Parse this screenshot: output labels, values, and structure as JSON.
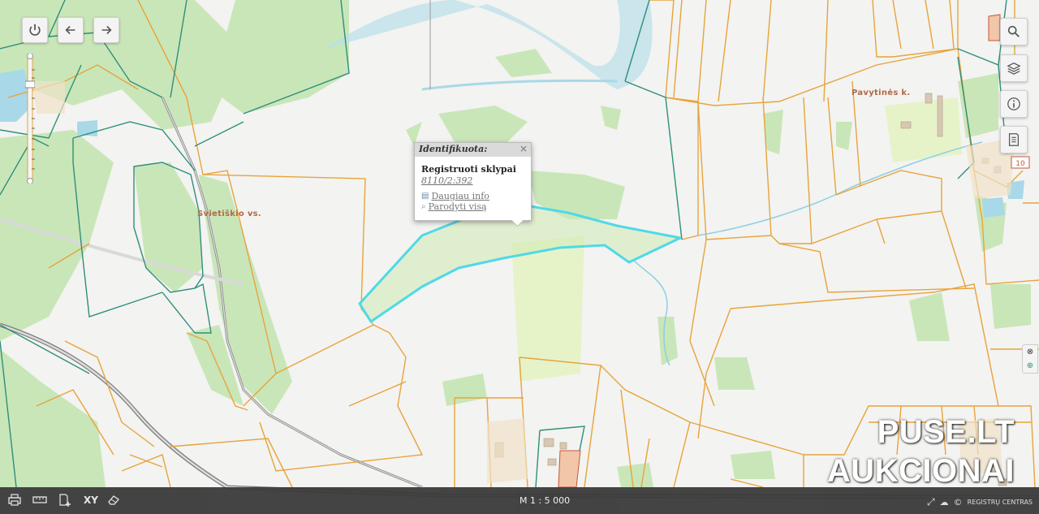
{
  "map": {
    "colors": {
      "background": "#f3f3f1",
      "forest": "#c9e6b9",
      "water": "#a9d8e8",
      "parcel_boundary": "#e8a33b",
      "admin_boundary": "#2e8f7a",
      "selected_parcel": "#4fd9e6",
      "road": "#7d7d7d"
    },
    "place_labels": [
      "Svietiškio vs.",
      "Pavytinės k."
    ],
    "road_numbers": [
      "10"
    ]
  },
  "top_left_controls": [
    {
      "name": "power-button",
      "icon": "power-icon"
    },
    {
      "name": "back-button",
      "icon": "arrow-left-icon"
    },
    {
      "name": "forward-button",
      "icon": "arrow-right-icon"
    }
  ],
  "right_controls": [
    {
      "name": "search-button",
      "icon": "search-icon"
    },
    {
      "name": "layers-button",
      "icon": "layers-icon"
    },
    {
      "name": "info-button",
      "icon": "info-icon"
    },
    {
      "name": "legend-button",
      "icon": "document-icon"
    }
  ],
  "popup": {
    "header": "Identifikuota:",
    "close": "×",
    "title": "Registruoti sklypai",
    "parcel_id": "8110/2:392",
    "more_info": "Daugiau info",
    "show_all": "Parodyti visą"
  },
  "bottom_bar": {
    "tools": [
      {
        "name": "print-tool",
        "icon": "printer-icon"
      },
      {
        "name": "measure-tool",
        "icon": "ruler-icon"
      },
      {
        "name": "add-document-tool",
        "icon": "add-document-icon"
      },
      {
        "name": "coordinates-tool",
        "label": "XY"
      },
      {
        "name": "eraser-tool",
        "icon": "eraser-icon"
      }
    ],
    "scale": "M 1 : 5 000",
    "credit": "REGISTRŲ CENTRAS"
  },
  "watermark": {
    "line1": "PUSE.LT",
    "line2": "AUKCIONAI"
  }
}
